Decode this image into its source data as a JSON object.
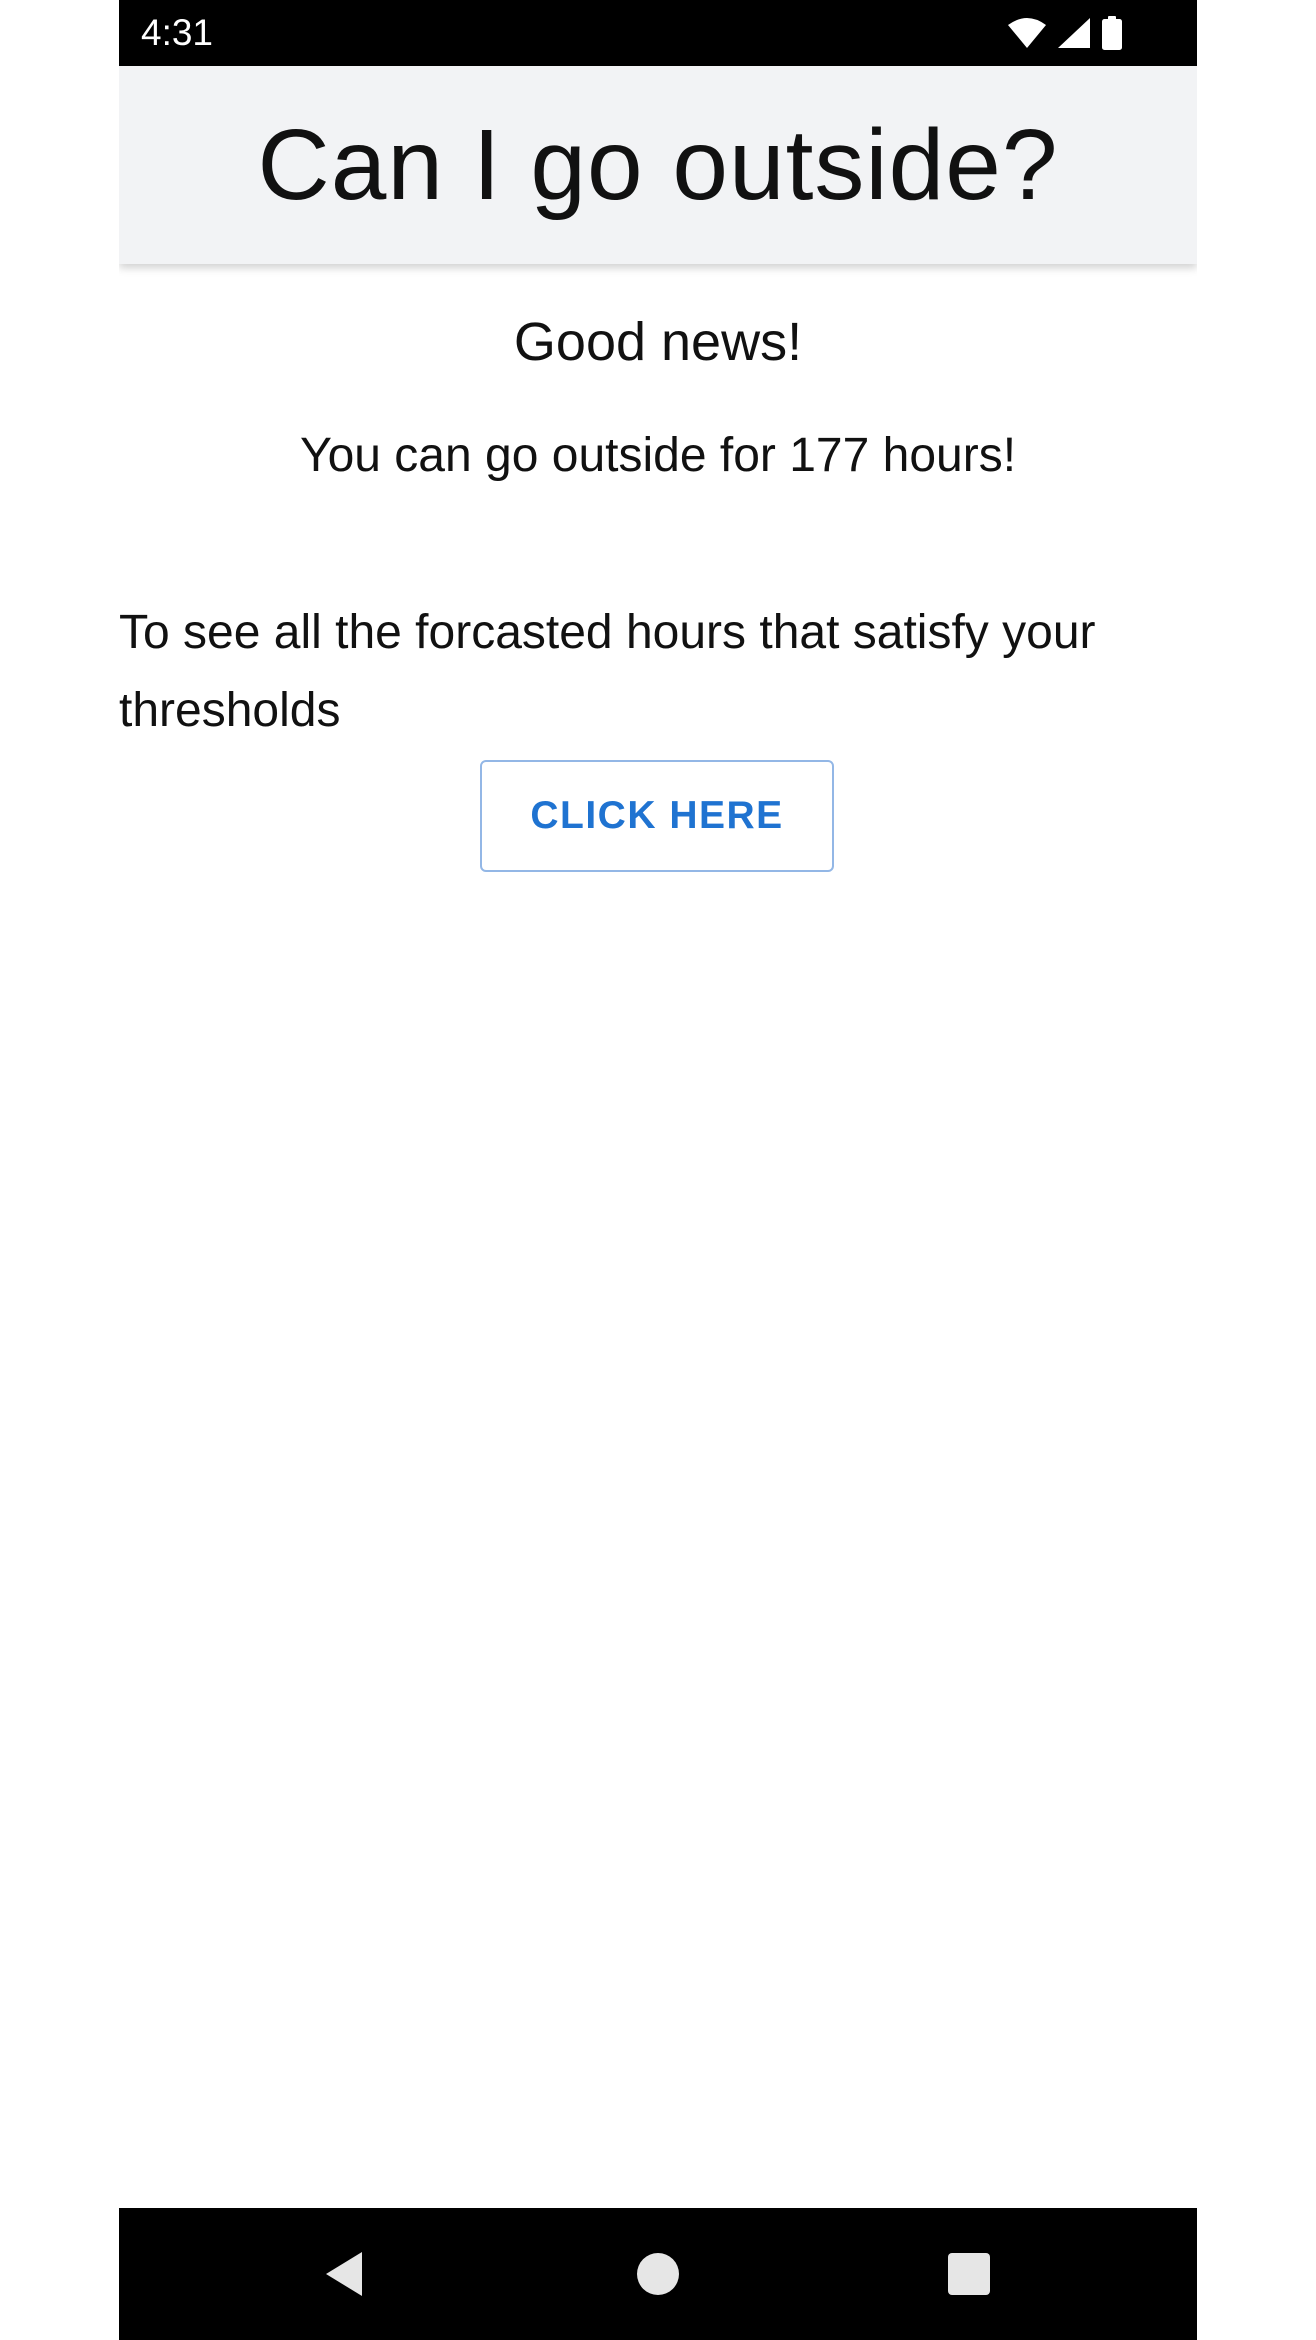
{
  "status_bar": {
    "time": "4:31",
    "icons": [
      "wifi-icon",
      "cell-signal-icon",
      "battery-icon"
    ]
  },
  "app_bar": {
    "title": "Can I go outside?"
  },
  "main": {
    "headline": "Good news!",
    "message": "You can go outside for 177 hours!",
    "info_text": "To see all the forcasted hours that satisfy your thresholds",
    "button_label": "CLICK HERE"
  },
  "nav_bar": {
    "icons": [
      "back-icon",
      "home-icon",
      "recents-icon"
    ]
  },
  "colors": {
    "status_bar_bg": "#000000",
    "app_bar_bg": "#f2f3f5",
    "button_text": "#1f73d1",
    "button_border": "#93b7e6",
    "nav_bar_bg": "#000000"
  }
}
